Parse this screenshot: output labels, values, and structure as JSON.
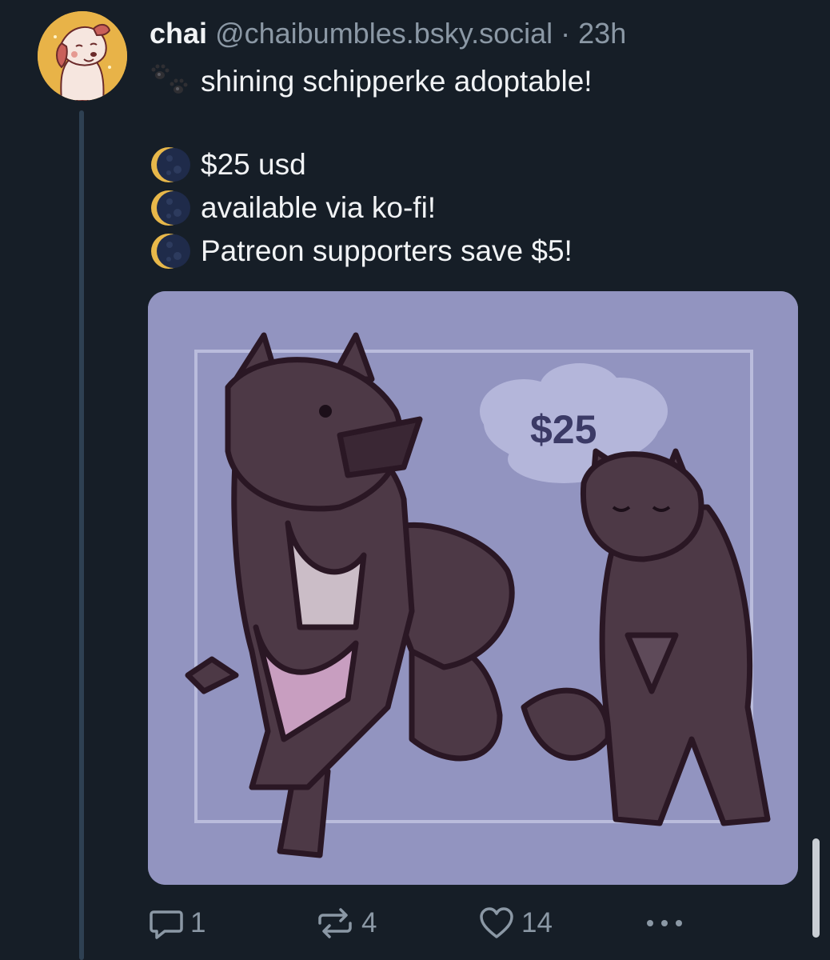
{
  "post": {
    "author_name": "chai",
    "handle": "@chaibumbles.bsky.social",
    "separator": "·",
    "time": "23h",
    "lines": [
      {
        "emoji": "paw-prints-icon",
        "text": "shining schipperke adoptable!"
      },
      {
        "emoji": "moon-icon",
        "text": "$25 usd"
      },
      {
        "emoji": "moon-icon",
        "text": "available via ko-fi!"
      },
      {
        "emoji": "moon-icon",
        "text": "Patreon supporters save $5!"
      }
    ],
    "image": {
      "price_tag": "$25"
    }
  },
  "actions": {
    "reply_count": "1",
    "repost_count": "4",
    "like_count": "14"
  },
  "colors": {
    "background": "#161e27",
    "image_bg": "#9294c0",
    "thread_line": "#2e4052",
    "muted_text": "#8b98a5"
  }
}
